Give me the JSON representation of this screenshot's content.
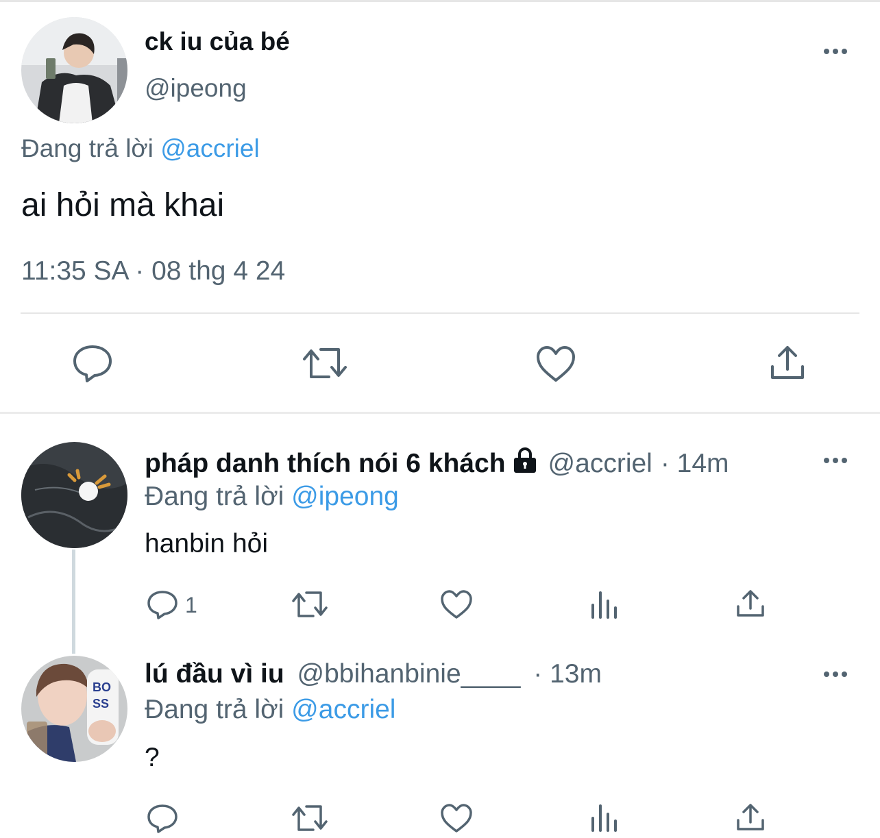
{
  "main_tweet": {
    "display_name": "ck iu của bé",
    "handle": "@ipeong",
    "replying_prefix": "Đang trả lời",
    "replying_to": "@accriel",
    "text": "ai hỏi mà khai",
    "timestamp": "11:35 SA · 08 thg 4 24",
    "actions": [
      "reply-icon",
      "retweet-icon",
      "like-icon",
      "share-icon"
    ]
  },
  "replies": [
    {
      "display_name": "pháp danh thích nói 6 khách",
      "protected": true,
      "handle": "@accriel",
      "time": "· 14m",
      "replying_prefix": "Đang trả lời",
      "replying_to": "@ipeong",
      "text": "hanbin hỏi",
      "reply_count": "1"
    },
    {
      "display_name": "lú đầu vì iu",
      "handle": "@bbihanbinie____",
      "time": "· 13m",
      "replying_prefix": "Đang trả lời",
      "replying_to": "@accriel",
      "text": "?"
    }
  ],
  "colors": {
    "link": "#3c9be6",
    "muted": "#536471",
    "text": "#0f1419"
  }
}
